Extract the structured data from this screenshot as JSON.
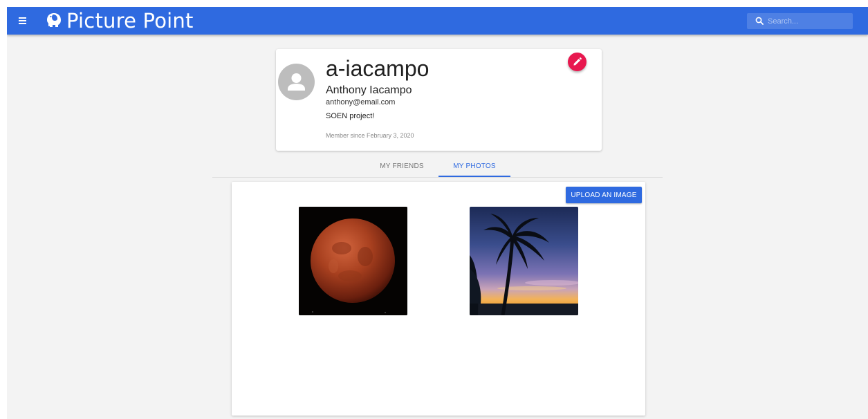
{
  "app": {
    "title": "Picture Point",
    "brand_color": "#2f6ae0",
    "logo_icon": "elephant-icon",
    "menu_icon": "hamburger-menu-icon"
  },
  "search": {
    "placeholder": "Search..."
  },
  "profile": {
    "username": "a-iacampo",
    "full_name": "Anthony Iacampo",
    "email": "anthony@email.com",
    "bio": "SOEN project!",
    "member_since": "Member since February 3, 2020",
    "avatar_icon": "person-icon",
    "edit_icon": "pencil-icon",
    "edit_button_color": "#e8184f"
  },
  "tabs": [
    {
      "label": "MY FRIENDS",
      "active": false
    },
    {
      "label": "MY PHOTOS",
      "active": true
    }
  ],
  "photos": {
    "upload_label": "UPLOAD AN IMAGE",
    "items": [
      {
        "subject": "blood moon"
      },
      {
        "subject": "palm tree at sunset"
      }
    ]
  }
}
